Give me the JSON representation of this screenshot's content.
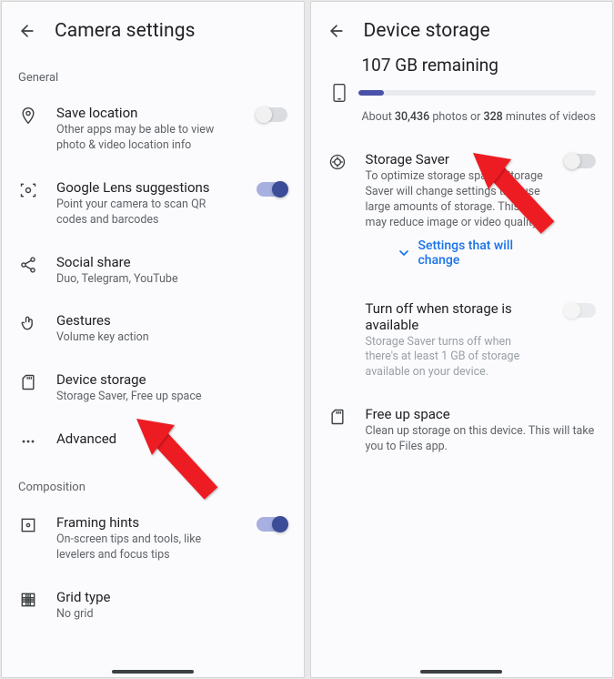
{
  "left": {
    "title": "Camera settings",
    "sections": {
      "general_label": "General",
      "composition_label": "Composition"
    },
    "items": {
      "save_location": {
        "title": "Save location",
        "subtitle": "Other apps may be able to view photo & video location info"
      },
      "lens": {
        "title": "Google Lens suggestions",
        "subtitle": "Point your camera to scan QR codes and barcodes"
      },
      "social": {
        "title": "Social share",
        "subtitle": "Duo, Telegram, YouTube"
      },
      "gestures": {
        "title": "Gestures",
        "subtitle": "Volume key action"
      },
      "storage": {
        "title": "Device storage",
        "subtitle": "Storage Saver, Free up space"
      },
      "advanced": {
        "title": "Advanced"
      },
      "framing": {
        "title": "Framing hints",
        "subtitle": "On-screen tips and tools, like levelers and focus tips"
      },
      "grid": {
        "title": "Grid type",
        "subtitle": "No grid"
      }
    }
  },
  "right": {
    "title": "Device storage",
    "remaining": "107 GB remaining",
    "estimate_prefix": "About ",
    "estimate_photos": "30,436",
    "estimate_mid": " photos or ",
    "estimate_minutes": "328",
    "estimate_suffix": " minutes of videos",
    "items": {
      "saver": {
        "title": "Storage Saver",
        "subtitle": "To optimize storage space, Storage Saver will change settings that use large amounts of storage. This may reduce image or video quality."
      },
      "expand": "Settings that will change",
      "turnoff": {
        "title": "Turn off when storage is available",
        "subtitle": "Storage Saver turns off when there's at least 1 GB of storage available on your device."
      },
      "freeup": {
        "title": "Free up space",
        "subtitle": "Clean up storage on this device. This will take you to Files app."
      }
    }
  },
  "colors": {
    "accent": "#3c4c99",
    "link": "#1a73e8",
    "arrow": "#ec1c24"
  }
}
